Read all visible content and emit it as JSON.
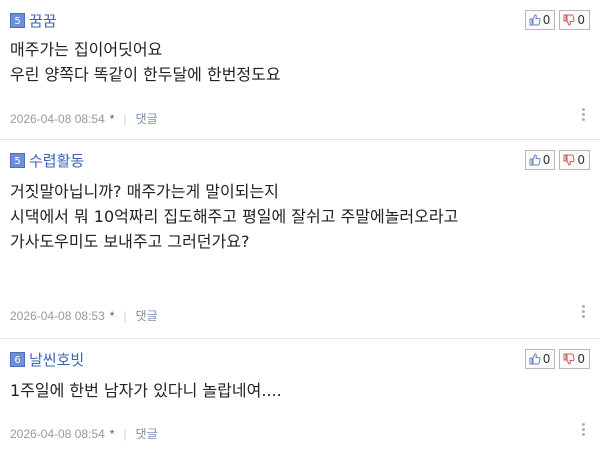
{
  "comments": [
    {
      "level": "5",
      "nickname": "꿈꿈",
      "lines": [
        "매주가는 집이어딧어요",
        "우린 양쪽다 똑같이 한두달에 한번정도요"
      ],
      "date": "2026-04-08 08:54",
      "star": "*",
      "separator": "|",
      "reply": "댓글",
      "likes": "0",
      "dislikes": "0"
    },
    {
      "level": "5",
      "nickname": "수렵활동",
      "lines": [
        "거짓말아닙니까? 매주가는게 말이되는지",
        "시댁에서 뭐 10억짜리 집도해주고 평일에 잘쉬고 주말에놀러오라고",
        "가사도우미도 보내주고 그러던가요?"
      ],
      "date": "2026-04-08 08:53",
      "star": "*",
      "separator": "|",
      "reply": "댓글",
      "likes": "0",
      "dislikes": "0"
    },
    {
      "level": "6",
      "nickname": "날씬호빗",
      "lines": [
        "1주일에 한번 남자가 있다니 놀랍네여...."
      ],
      "date": "2026-04-08 08:54",
      "star": "*",
      "separator": "|",
      "reply": "댓글",
      "likes": "0",
      "dislikes": "0"
    }
  ],
  "icons": {
    "like": "thumb-up-icon",
    "dislike": "thumb-down-icon",
    "more": "more-vertical-icon"
  },
  "colors": {
    "nickname": "#3a63b8",
    "level_badge": "#6d8fd6",
    "meta": "#9a9a9a"
  }
}
